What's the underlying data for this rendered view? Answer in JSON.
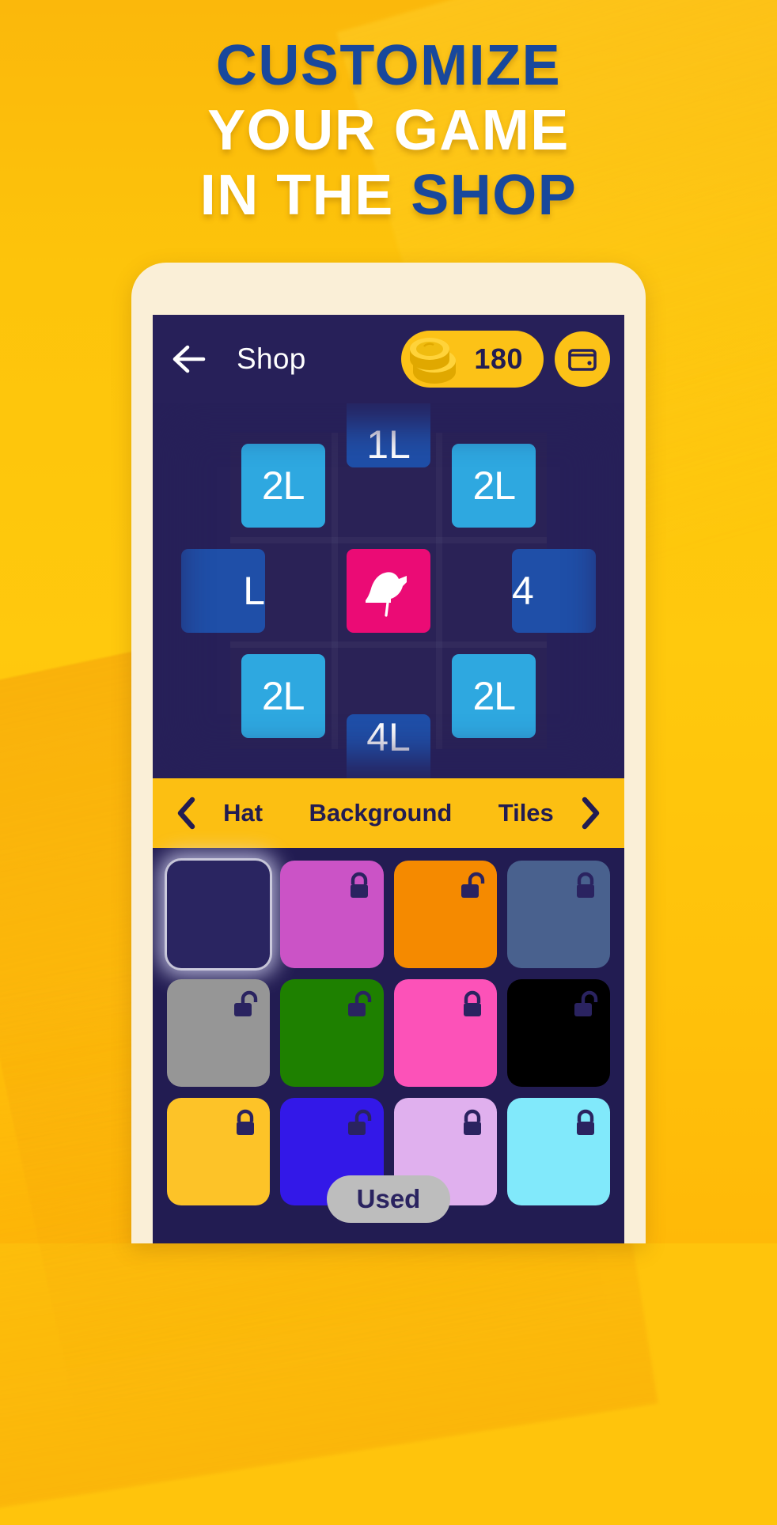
{
  "promo": {
    "headline_line1": "CUSTOMIZE",
    "headline_line2": "YOUR GAME",
    "headline_line3_white": "IN THE ",
    "headline_line3_blue": "SHOP",
    "bg_color": "#FFC40C",
    "accent_blue": "#18489C"
  },
  "app": {
    "header": {
      "back_icon": "arrow-left-icon",
      "title": "Shop",
      "coin_icon": "coin-stack-icon",
      "coin_count": "180",
      "wallet_icon": "wallet-icon",
      "bar_color": "#272059",
      "pill_color": "#FCC217"
    },
    "board_preview": {
      "background_color": "#272059",
      "tiles": [
        {
          "label": "2L",
          "style": "light"
        },
        {
          "label": "",
          "style": "empty"
        },
        {
          "label": "2L",
          "style": "light"
        },
        {
          "label": "",
          "style": "empty"
        },
        {
          "label": "bird-icon",
          "style": "center"
        },
        {
          "label": "",
          "style": "empty"
        },
        {
          "label": "2L",
          "style": "light"
        },
        {
          "label": "",
          "style": "empty"
        },
        {
          "label": "2L",
          "style": "light"
        }
      ],
      "edge_tiles": {
        "top": "1L",
        "bottom": "4L",
        "left": "L",
        "right": "4"
      },
      "tile_light_color": "#2EA8E0",
      "tile_center_color": "#EB0B75",
      "tile_edge_color": "#1F4FA8"
    },
    "tabs": {
      "prev_icon": "chevron-left-icon",
      "next_icon": "chevron-right-icon",
      "items": [
        {
          "label": "Hat",
          "active": false
        },
        {
          "label": "Background",
          "active": true
        },
        {
          "label": "Tiles",
          "active": false
        }
      ],
      "bar_color": "#FCBF12"
    },
    "swatches": [
      {
        "color": "#2A2561",
        "locked": false,
        "selected": true,
        "lock_icon": ""
      },
      {
        "color": "#CB53C6",
        "locked": true,
        "selected": false,
        "lock_icon": "lock-closed-icon"
      },
      {
        "color": "#F58A00",
        "locked": false,
        "selected": false,
        "lock_icon": "lock-open-icon"
      },
      {
        "color": "#49618E",
        "locked": true,
        "selected": false,
        "lock_icon": "lock-closed-icon"
      },
      {
        "color": "#969696",
        "locked": false,
        "selected": false,
        "lock_icon": "lock-open-icon"
      },
      {
        "color": "#1E8000",
        "locked": false,
        "selected": false,
        "lock_icon": "lock-open-icon"
      },
      {
        "color": "#FC52B8",
        "locked": true,
        "selected": false,
        "lock_icon": "lock-closed-icon"
      },
      {
        "color": "#000000",
        "locked": false,
        "selected": false,
        "lock_icon": "lock-open-icon"
      },
      {
        "color": "#FDC328",
        "locked": true,
        "selected": false,
        "lock_icon": "lock-closed-icon"
      },
      {
        "color": "#3318E8",
        "locked": false,
        "selected": false,
        "lock_icon": "lock-open-icon"
      },
      {
        "color": "#E0B0EE",
        "locked": true,
        "selected": false,
        "lock_icon": "lock-closed-icon"
      },
      {
        "color": "#81E9FB",
        "locked": true,
        "selected": false,
        "lock_icon": "lock-closed-icon"
      }
    ],
    "used_button": {
      "label": "Used",
      "color": "#BDBDBD"
    },
    "screen_bg": "#221C52"
  }
}
